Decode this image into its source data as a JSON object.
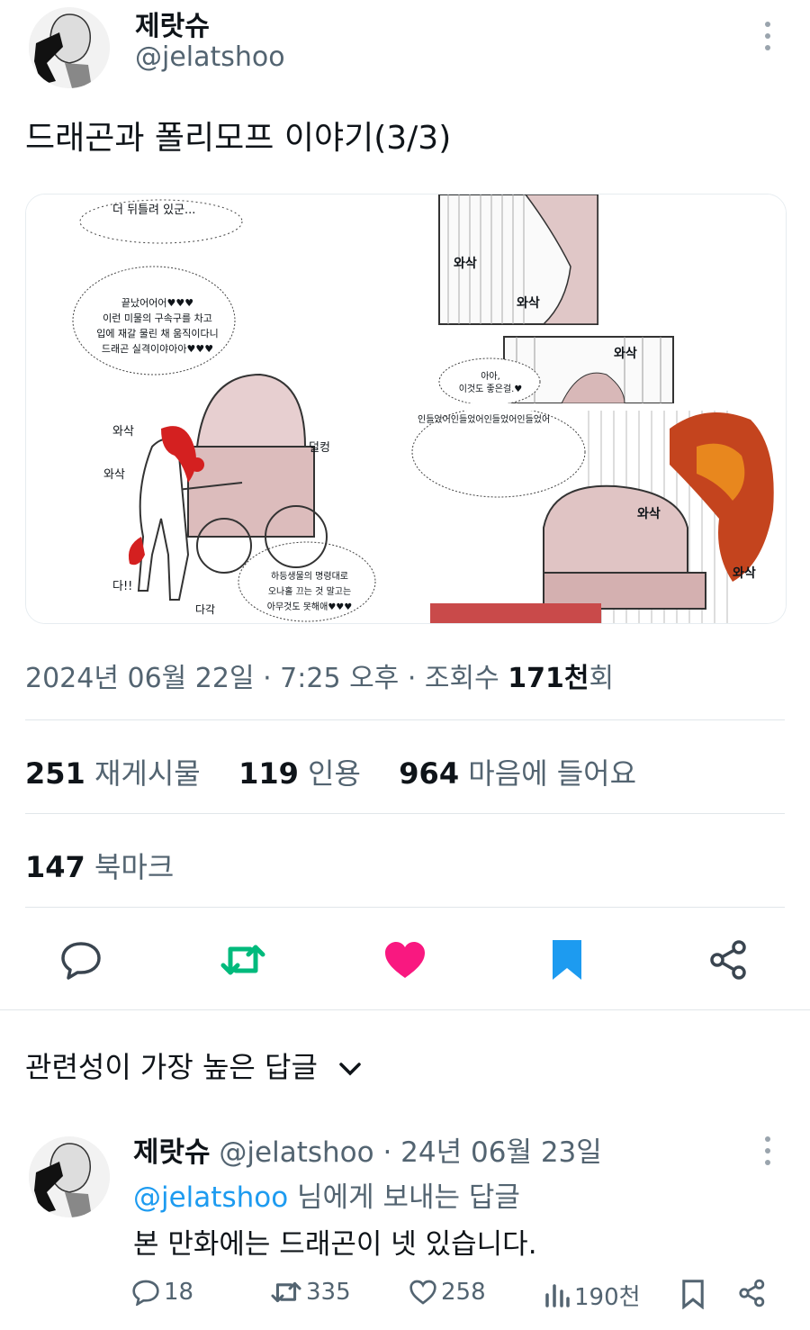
{
  "author": {
    "name": "제랏슈",
    "handle": "@jelatshoo"
  },
  "tweet": {
    "text": "드래곤과 폴리모프 이야기(3/3)",
    "meta_date": "2024년 06월 22일 · 7:25 오후 · 조회수 ",
    "meta_views": "171천",
    "meta_suffix": "회"
  },
  "comic": {
    "bubble_top": "더 뒤틀려 있군...",
    "bubble_mid": [
      "끝났어어어♥♥♥",
      "이런 미물의 구속구를 차고",
      "입에 재갈 물린 채 움직이다니",
      "드래곤 실격이야아아♥♥♥"
    ],
    "bubble_bottom": [
      "하등생물의 명령대로",
      "오나홀 끄는 것 말고는",
      "아무것도 못해애♥♥♥"
    ],
    "sfx": [
      "와삭",
      "와삭",
      "다!!",
      "다각",
      "덜컹"
    ],
    "panel2_sfx": [
      "와삭",
      "와삭",
      "와삭"
    ],
    "panel2_bubble": [
      "아아,",
      "이것도 좋은걸.♥"
    ],
    "panel3_text": "인들었어인들었어인들었어인들었어",
    "panel3_sfx": [
      "와삭",
      "와삭"
    ]
  },
  "stats": {
    "reposts_num": "251",
    "reposts_label": "재게시물",
    "quotes_num": "119",
    "quotes_label": "인용",
    "likes_num": "964",
    "likes_label": "마음에 들어요",
    "bookmarks_num": "147",
    "bookmarks_label": "북마크"
  },
  "actions": {
    "reply": "reply-icon",
    "repost": "repost-icon",
    "like": "heart-icon",
    "bookmark": "bookmark-icon",
    "share": "share-icon"
  },
  "replies_header": "관련성이 가장 높은 답글",
  "reply": {
    "name": "제랏슈",
    "handle": "@jelatshoo",
    "date": "· 24년 06월 23일",
    "to_handle": "@jelatshoo",
    "to_suffix": " 님에게 보내는 답글",
    "text": "본 만화에는 드래곤이 넷 있습니다.",
    "replies": "18",
    "reposts": "335",
    "likes": "258",
    "views": "190천"
  },
  "colors": {
    "like": "#f91880",
    "repost": "#00ba7c",
    "bookmark": "#1d9bf0",
    "link": "#1d9bf0"
  }
}
